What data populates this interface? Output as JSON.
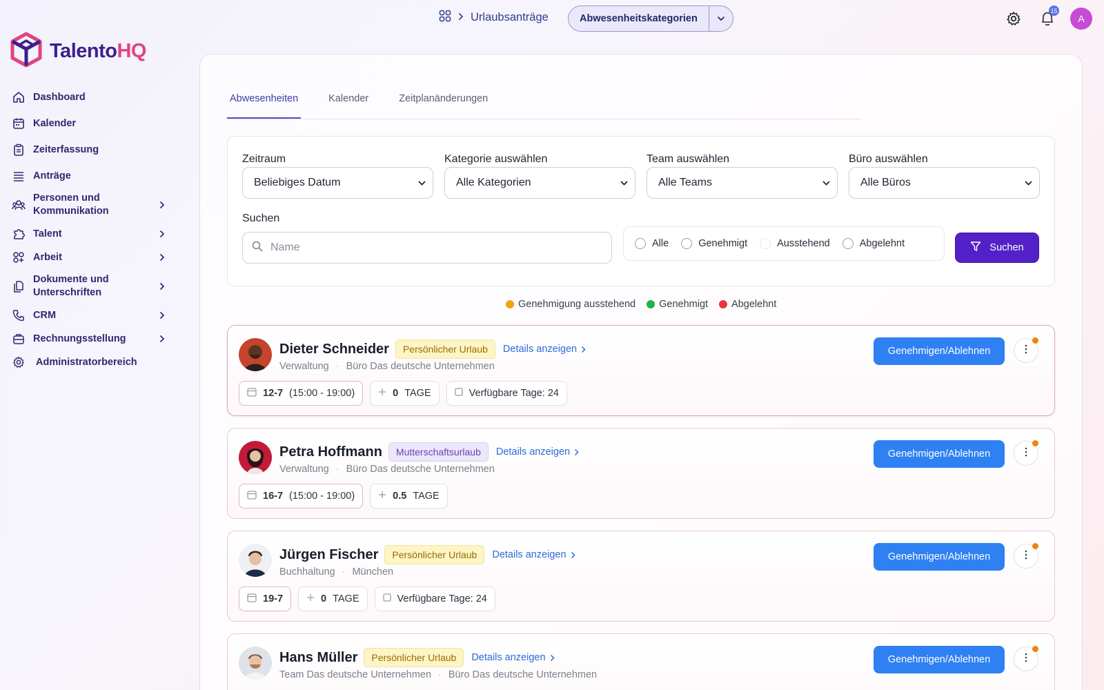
{
  "brand": {
    "part1": "Talento",
    "part2": "HQ",
    "color1": "#3b1f8f",
    "color2": "#e0457b"
  },
  "sidebar": {
    "items": [
      {
        "label": "Dashboard",
        "icon": "home-icon",
        "has_chevron": false
      },
      {
        "label": "Kalender",
        "icon": "calendar-icon",
        "has_chevron": false
      },
      {
        "label": "Zeiterfassung",
        "icon": "clipboard-icon",
        "has_chevron": false
      },
      {
        "label": "Anträge",
        "icon": "list-icon",
        "has_chevron": false
      },
      {
        "label": "Personen und Kommunikation",
        "icon": "people-icon",
        "has_chevron": true
      },
      {
        "label": "Talent",
        "icon": "puzzle-icon",
        "has_chevron": true
      },
      {
        "label": "Arbeit",
        "icon": "grid-icon",
        "has_chevron": true
      },
      {
        "label": "Dokumente und Unterschriften",
        "icon": "documents-icon",
        "has_chevron": true
      },
      {
        "label": "CRM",
        "icon": "phone-icon",
        "has_chevron": true
      },
      {
        "label": "Rechnungsstellung",
        "icon": "briefcase-icon",
        "has_chevron": true
      },
      {
        "label": "Administratorbereich",
        "icon": "gear-icon",
        "has_chevron": false
      }
    ]
  },
  "topbar": {
    "breadcrumb": "Urlaubsanträge",
    "category_button": "Abwesenheitskategorien",
    "notification_count": "15",
    "avatar_letter": "A"
  },
  "tabs": [
    {
      "label": "Abwesenheiten",
      "active": true
    },
    {
      "label": "Kalender",
      "active": false
    },
    {
      "label": "Zeitplanänderungen",
      "active": false
    }
  ],
  "filters": {
    "period_label": "Zeitraum",
    "period_value": "Beliebiges Datum",
    "category_label": "Kategorie auswählen",
    "category_value": "Alle Kategorien",
    "team_label": "Team auswählen",
    "team_value": "Alle Teams",
    "office_label": "Büro auswählen",
    "office_value": "Alle Büros",
    "search_label": "Suchen",
    "search_placeholder": "Name",
    "search_button": "Suchen",
    "status_options": [
      "Alle",
      "Genehmigt",
      "Ausstehend",
      "Abgelehnt"
    ]
  },
  "legend": [
    {
      "label": "Genehmigung ausstehend",
      "color": "#f0a413"
    },
    {
      "label": "Genehmigt",
      "color": "#1fb24a"
    },
    {
      "label": "Abgelehnt",
      "color": "#e8353b"
    }
  ],
  "requests": [
    {
      "name": "Dieter Schneider",
      "type": "Persönlicher Urlaub",
      "type_style": "yellow",
      "details": "Details anzeigen",
      "department": "Verwaltung",
      "office": "Büro Das deutsche Unternehmen",
      "date": "12-7",
      "time": "(15:00 - 19:00)",
      "days": "0",
      "days_unit": "TAGE",
      "available": "Verfügbare Tage: 24",
      "action": "Genehmigen/Ablehnen"
    },
    {
      "name": "Petra Hoffmann",
      "type": "Mutterschaftsurlaub",
      "type_style": "purple",
      "details": "Details anzeigen",
      "department": "Verwaltung",
      "office": "Büro Das deutsche Unternehmen",
      "date": "16-7",
      "time": "(15:00 - 19:00)",
      "days": "0.5",
      "days_unit": "TAGE",
      "available": "",
      "action": "Genehmigen/Ablehnen"
    },
    {
      "name": "Jürgen Fischer",
      "type": "Persönlicher Urlaub",
      "type_style": "yellow",
      "details": "Details anzeigen",
      "department": "Buchhaltung",
      "office": "München",
      "date": "19-7",
      "time": "",
      "days": "0",
      "days_unit": "TAGE",
      "available": "Verfügbare Tage: 24",
      "action": "Genehmigen/Ablehnen"
    },
    {
      "name": "Hans Müller",
      "type": "Persönlicher Urlaub",
      "type_style": "yellow",
      "details": "Details anzeigen",
      "department": "Team Das deutsche Unternehmen",
      "office": "Büro Das deutsche Unternehmen",
      "date": "",
      "time": "",
      "days": "",
      "days_unit": "",
      "available": "",
      "action": "Genehmigen/Ablehnen"
    }
  ]
}
